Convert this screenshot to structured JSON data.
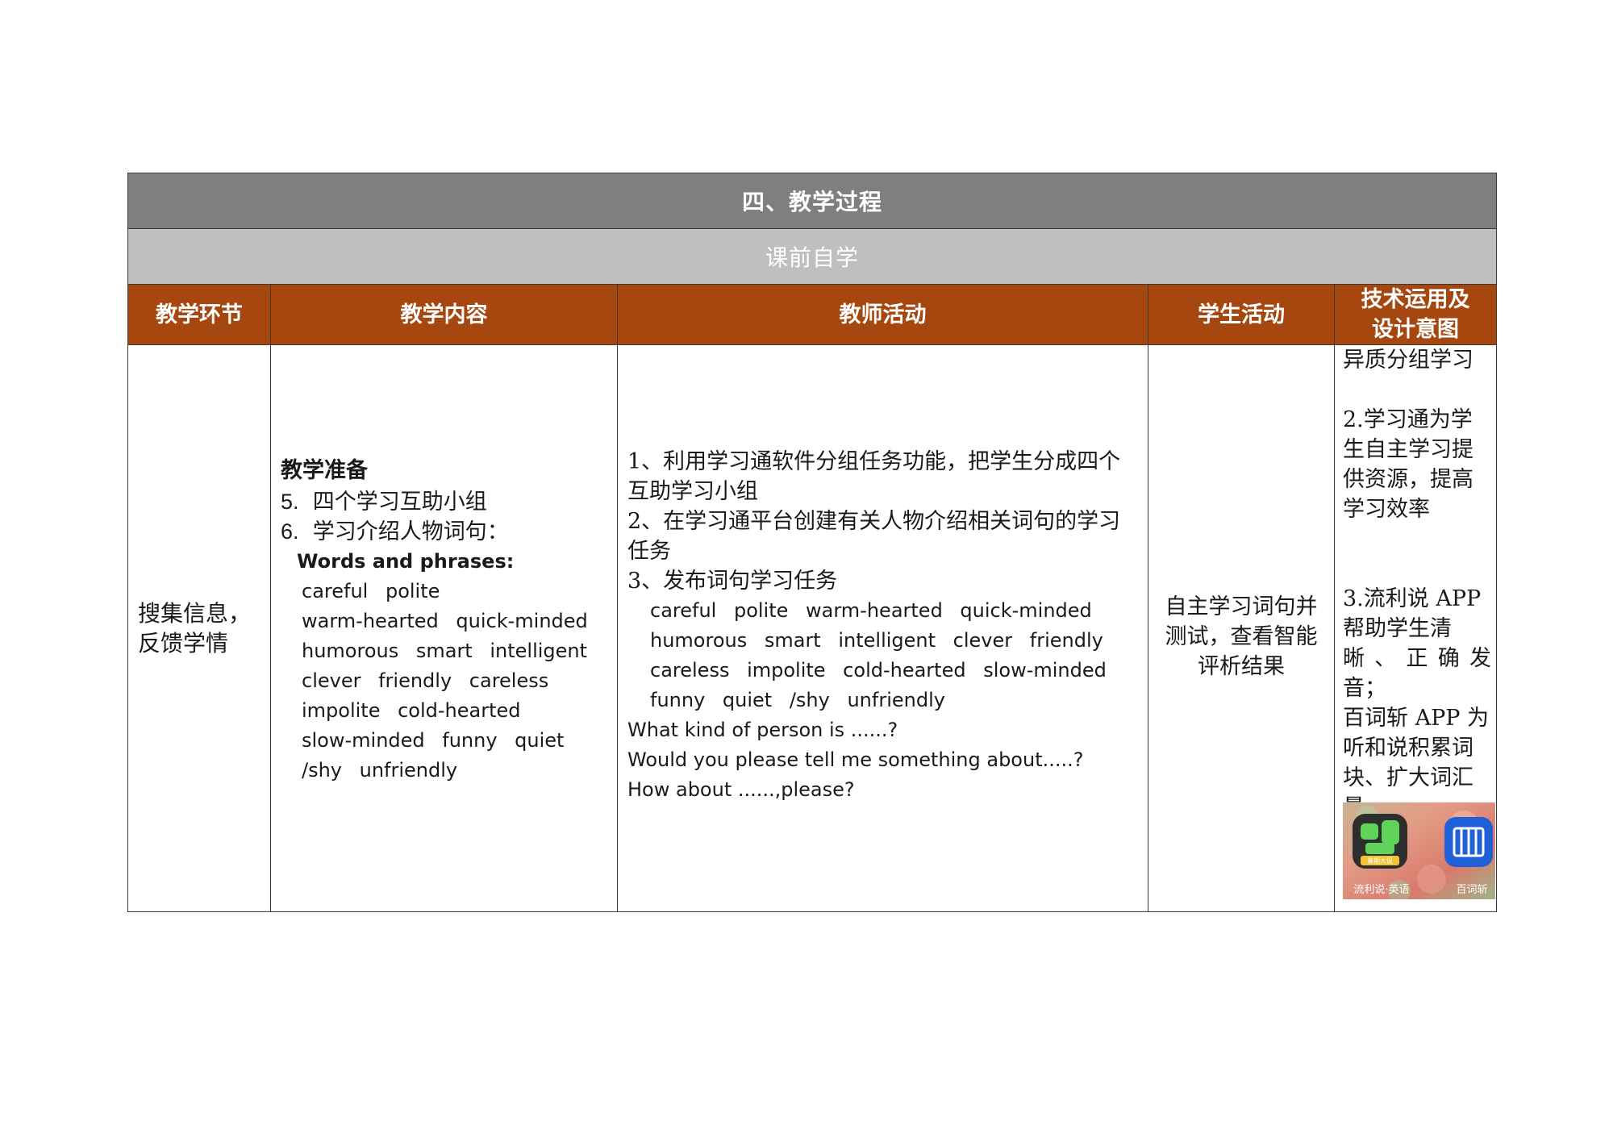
{
  "table": {
    "title": "四、教学过程",
    "subtitle": "课前自学",
    "headers": {
      "stage": "教学环节",
      "content": "教学内容",
      "teacher": "教师活动",
      "student": "学生活动",
      "design_line1": "技术运用及",
      "design_line2": "设计意图"
    },
    "row": {
      "stage": [
        "搜集信息，",
        "反馈学情"
      ],
      "content": {
        "heading": "教学准备",
        "item5_num": "5.",
        "item5_text": "四个学习互助小组",
        "item6_num": "6.",
        "item6_text": "学习介绍人物词句：",
        "words_title": "Words and phrases:",
        "word_lines": [
          "careful polite",
          "warm-hearted quick-minded",
          "humorous smart intelligent",
          "clever friendly careless",
          "impolite cold-hearted",
          "slow-minded funny quiet",
          "/shy unfriendly"
        ]
      },
      "teacher": {
        "lines": [
          "1、利用学习通软件分组任务功能，把学生分成四个",
          "互助学习小组",
          "2、在学习通平台创建有关人物介绍相关词句的学习",
          "任务",
          "3、发布词句学习任务"
        ],
        "word_lines": [
          "careful polite warm-hearted quick-minded",
          "humorous smart intelligent clever friendly",
          "careless impolite cold-hearted slow-minded",
          "funny quiet /shy unfriendly"
        ],
        "sentences": [
          "What kind of person is ......?",
          "Would you please tell me something about.....?",
          "How about ......,please?"
        ]
      },
      "student": [
        "自主学习词句并",
        "测试，查看智能",
        "评析结果"
      ],
      "design": {
        "p1": "异质分组学习",
        "p2": [
          "2.学习通为学",
          "生自主学习提",
          "供资源，提高",
          "学习效率"
        ],
        "p3": [
          "3.流利说 APP",
          "帮助学生清",
          "晰、正确发音；",
          "百词斩 APP 为",
          "听和说积累词",
          "块、扩大词汇",
          "量"
        ],
        "app_label_left": "流利说·英语",
        "app_label_right": "百词斩",
        "app_badge": "暑期大促"
      }
    }
  }
}
